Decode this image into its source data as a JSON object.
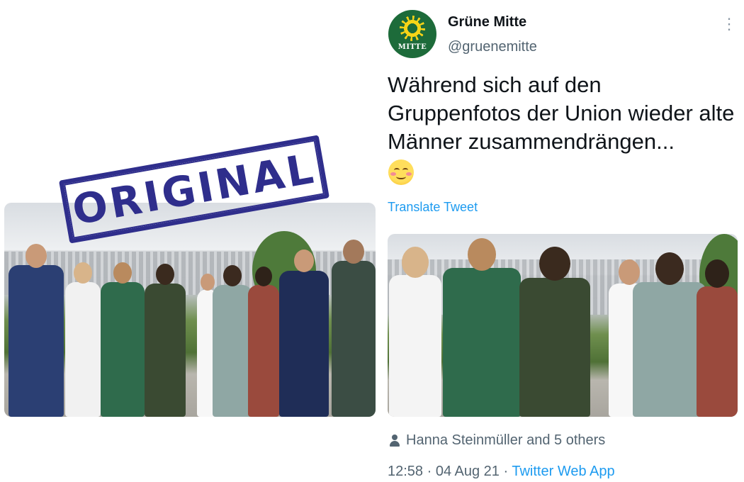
{
  "stamp": {
    "text": "ORIGINAL"
  },
  "tweet": {
    "author_name": "Grüne Mitte",
    "handle": "@gruenemitte",
    "avatar_text": "MITTE",
    "text": "Während sich auf den Gruppenfotos der Union wieder alte Männer zusammendrängen...",
    "emoji": "smiling-face-with-blushing-cheeks",
    "translate_label": "Translate Tweet",
    "likes_text": "Hanna Steinmüller and 5 others",
    "time": "12:58",
    "date": "04 Aug 21",
    "source": "Twitter Web App",
    "separator": " · "
  },
  "colors": {
    "stamp": "#2f2e8c",
    "link": "#1d9bf0",
    "avatar_bg": "#1d6b3a",
    "sunflower": "#f7d417"
  }
}
